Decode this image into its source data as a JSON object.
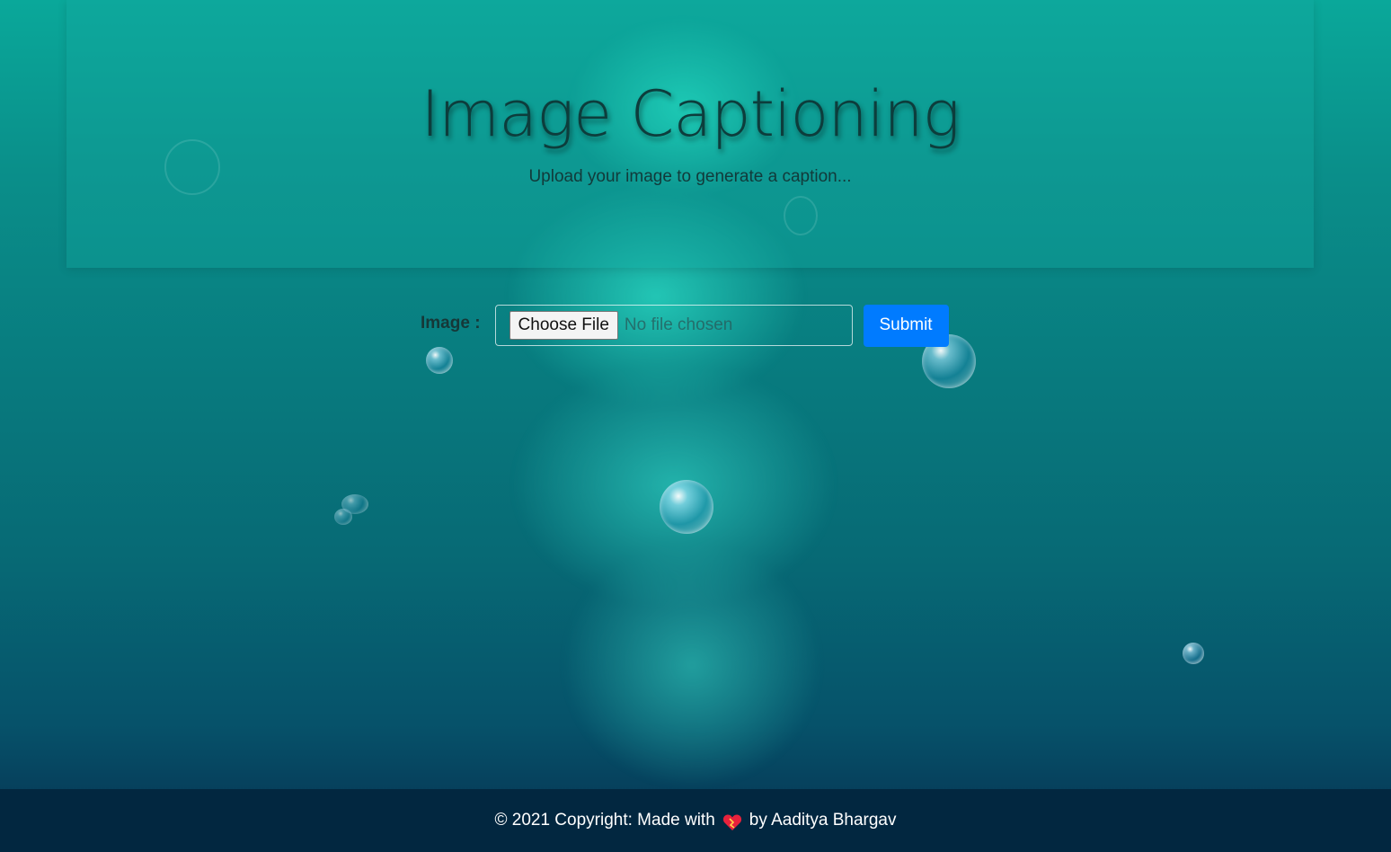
{
  "header": {
    "title": "Image Captioning",
    "subtitle": "Upload your image to generate a caption..."
  },
  "form": {
    "image_label": "Image :",
    "choose_file_label": "Choose File",
    "file_status": "No file chosen",
    "submit_label": "Submit"
  },
  "footer": {
    "text_before": "© 2021 Copyright: Made with",
    "heart_icon": "heart-icon",
    "text_after": "by Aaditya Bhargav"
  },
  "colors": {
    "submit_button": "#007bff",
    "footer_bg": "#022740",
    "heart": "#e8223c"
  }
}
